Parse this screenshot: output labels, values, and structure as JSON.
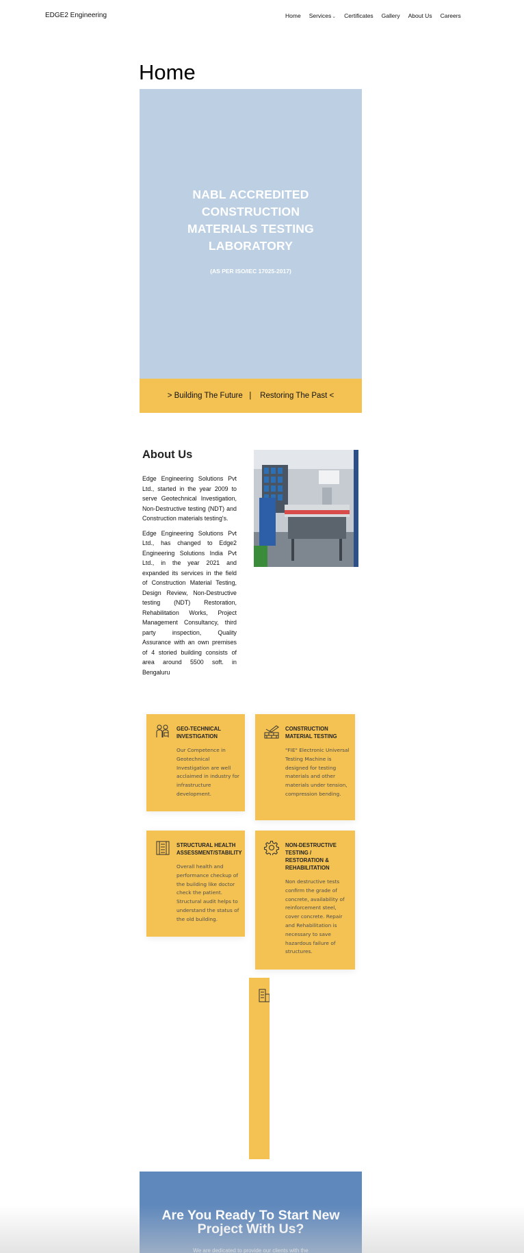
{
  "header": {
    "brand": "EDGE2 Engineering",
    "nav": [
      {
        "label": "Home"
      },
      {
        "label": "Services"
      },
      {
        "label": "Certificates"
      },
      {
        "label": "Gallery"
      },
      {
        "label": "About Us"
      },
      {
        "label": "Careers"
      }
    ]
  },
  "page_title": "Home",
  "hero": {
    "title": "NABL ACCREDITED CONSTRUCTION MATERIALS TESTING LABORATORY",
    "subtitle": "(AS PER ISO/IEC 17025-2017)",
    "background_color": "#bccfe3"
  },
  "tagline": "> Building The Future   |    Restoring The Past <",
  "about": {
    "heading": "About Us",
    "paragraphs": [
      "Edge Engineering Solutions Pvt Ltd., started in the year 2009 to serve Geotechnical Investigation, Non-Destructive testing (NDT) and Construction materials testing's.",
      "Edge Engineering Solutions Pvt Ltd., has changed to Edge2 Engineering Solutions India Pvt Ltd., in the year 2021 and expanded its services in the field of Construction Material Testing, Design Review, Non-Destructive testing (NDT) Restoration, Rehabilitation Works, Project Management Consultancy, third party inspection, Quality Assurance with an own premises of 4 storied building consists of area around 5500 soft. in Bengaluru"
    ]
  },
  "services": [
    {
      "title": "GEO-TECHNICAL INVESTIGATION",
      "description": "Our Competence in Geotechnical Investigation are well acclaimed in industry for infrastructure development.",
      "icon": "engineers-icon"
    },
    {
      "title": "CONSTRUCTION MATERIAL TESTING",
      "description": "\"FIE\" Electronic Universal Testing Machine is designed for testing materials and other materials under tension, compression bending.",
      "icon": "brick-trowel-icon"
    },
    {
      "title": "STRUCTURAL HEALTH ASSESSMENT/STABILITY",
      "description": "Overall health and performance checkup of the building like doctor check the patient. Structural audit helps to understand the status of the old building.",
      "icon": "building-icon"
    },
    {
      "title": "NON-DESTRUCTIVE TESTING / RESTORATION & REHABILITATION",
      "description": "Non destructive tests confirm the grade of concrete, availability of reinforcement steel, cover concrete. Repair and Rehabilitation is necessary to save hazardous failure of structures.",
      "icon": "gear-icon"
    }
  ],
  "partial_service_icon": "buildings-icon",
  "cta": {
    "title": "Are You Ready To Start New Project With Us?",
    "text": "We are dedicated to provide our clients with the"
  },
  "colors": {
    "accent_yellow": "#f4c252",
    "cta_blue": "#5f88bc"
  }
}
